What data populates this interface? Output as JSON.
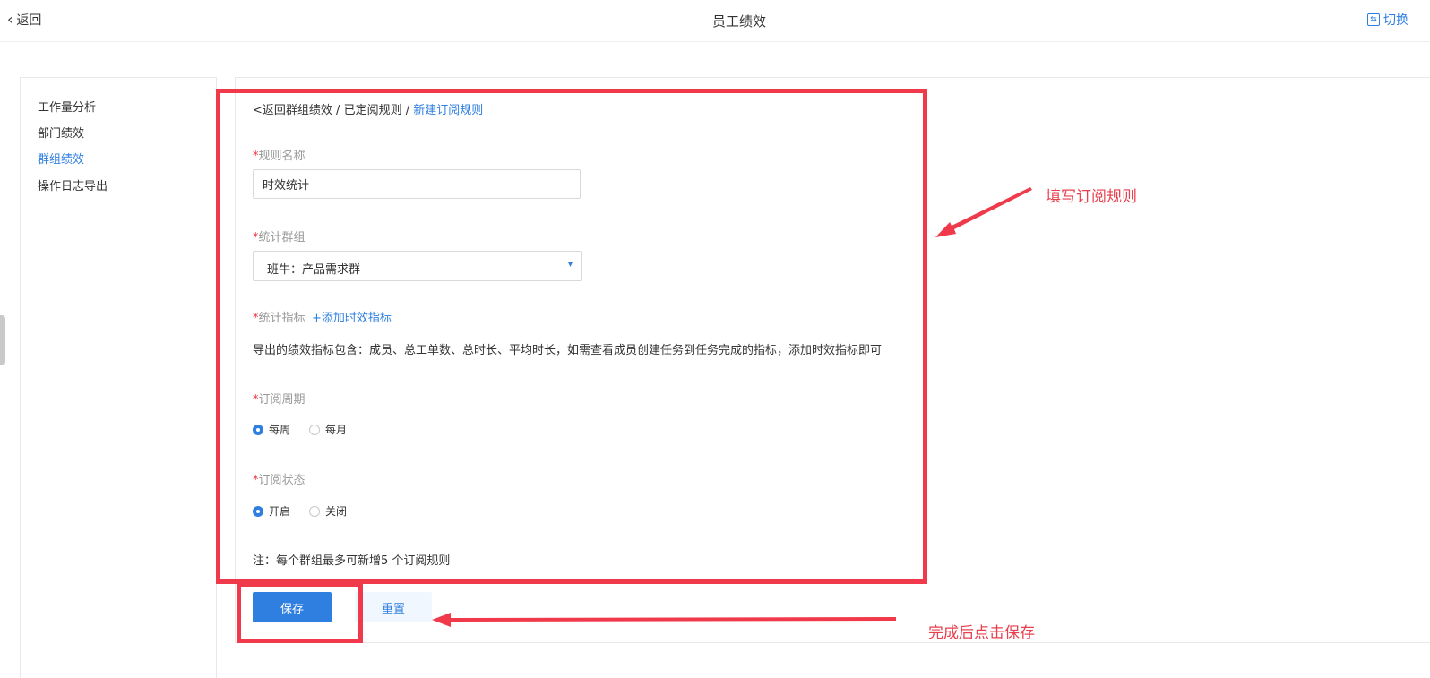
{
  "header": {
    "back_label": "返回",
    "title": "员工绩效",
    "switch_label": "切换"
  },
  "sidebar": {
    "items": [
      {
        "label": "工作量分析",
        "active": false
      },
      {
        "label": "部门绩效",
        "active": false
      },
      {
        "label": "群组绩效",
        "active": true
      },
      {
        "label": "操作日志导出",
        "active": false
      }
    ]
  },
  "breadcrumb": {
    "back": "<返回群组绩效",
    "sep1": " / ",
    "parent": "已定阅规则",
    "sep2": " / ",
    "current": "新建订阅规则"
  },
  "form": {
    "required_mark": "*",
    "rule_name_label": "规则名称",
    "rule_name_value": "时效统计",
    "group_label": "统计群组",
    "group_value": "班牛：产品需求群",
    "metrics_label": "统计指标",
    "add_metric_link": "+添加时效指标",
    "metrics_desc": "导出的绩效指标包含：成员、总工单数、总时长、平均时长，如需查看成员创建任务到任务完成的指标，添加时效指标即可",
    "cycle_label": "订阅周期",
    "cycle_options": [
      {
        "label": "每周",
        "checked": true
      },
      {
        "label": "每月",
        "checked": false
      }
    ],
    "status_label": "订阅状态",
    "status_options": [
      {
        "label": "开启",
        "checked": true
      },
      {
        "label": "关闭",
        "checked": false
      }
    ],
    "note": "注：每个群组最多可新增5 个订阅规则"
  },
  "actions": {
    "save_label": "保存",
    "reset_label": "重置"
  },
  "annotations": {
    "fill_rule": "填写订阅规则",
    "click_save": "完成后点击保存",
    "color": "#f0394a"
  },
  "colors": {
    "accent": "#2f7fe0",
    "required": "#f5313d"
  }
}
